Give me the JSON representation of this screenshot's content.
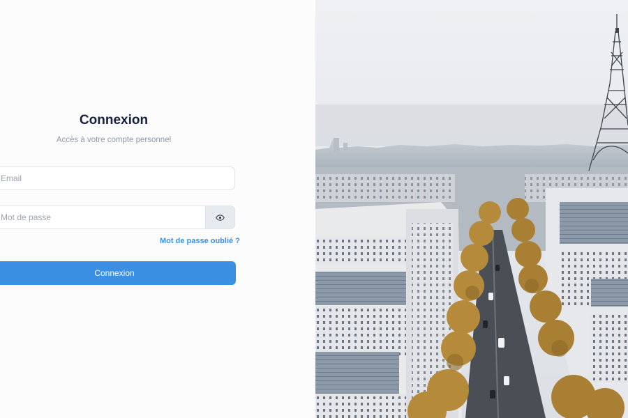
{
  "login": {
    "title": "Connexion",
    "subtitle": "Accès à votre compte personnel",
    "email": {
      "placeholder": "Email",
      "value": ""
    },
    "password": {
      "placeholder": "Mot de passe",
      "value": ""
    },
    "show_password_icon": "eye-icon",
    "forgot_link": "Mot de passe oublié ?",
    "submit_label": "Connexion"
  },
  "hero_image": {
    "subject": "Paris skyline with the Eiffel Tower and a tree-lined avenue"
  },
  "colors": {
    "accent": "#3b8fe3",
    "link": "#3b8ee0",
    "title": "#16213a",
    "muted": "#8f98a6",
    "background": "#fcfcfd"
  }
}
